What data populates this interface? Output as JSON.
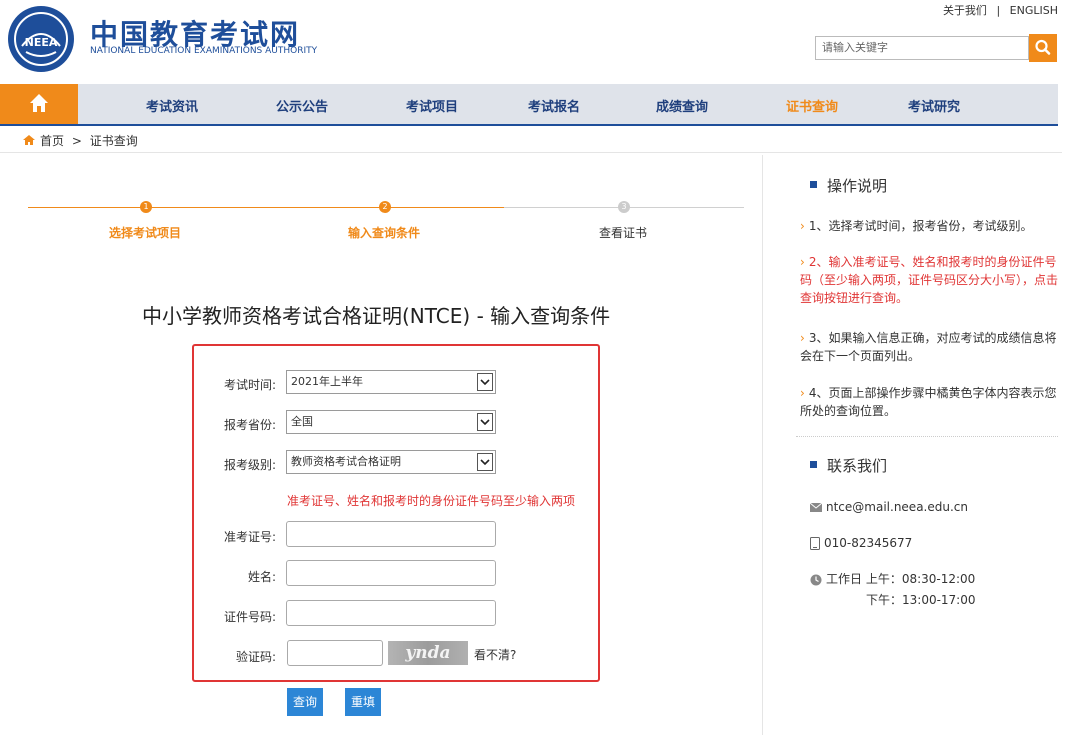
{
  "header": {
    "title": "中国教育考试网",
    "subtitle": "NATIONAL EDUCATION EXAMINATIONS AUTHORITY",
    "logo_text": "NEEA",
    "top_links": {
      "about": "关于我们",
      "sep": "|",
      "english": "ENGLISH"
    },
    "search_placeholder": "请输入关键字"
  },
  "nav": {
    "items": [
      {
        "label": "考试资讯"
      },
      {
        "label": "公示公告"
      },
      {
        "label": "考试项目"
      },
      {
        "label": "考试报名"
      },
      {
        "label": "成绩查询"
      },
      {
        "label": "证书查询",
        "active": true
      },
      {
        "label": "考试研究"
      }
    ]
  },
  "breadcrumb": {
    "home": "首页",
    "sep": ">",
    "current": "证书查询"
  },
  "steps": [
    {
      "num": "1",
      "label": "选择考试项目",
      "state": "done"
    },
    {
      "num": "2",
      "label": "输入查询条件",
      "state": "current"
    },
    {
      "num": "3",
      "label": "查看证书",
      "state": "pending"
    }
  ],
  "main": {
    "title": "中小学教师资格考试合格证明(NTCE) - 输入查询条件",
    "form": {
      "exam_time": {
        "label": "考试时间:",
        "value": "2021年上半年"
      },
      "province": {
        "label": "报考省份:",
        "value": "全国"
      },
      "level": {
        "label": "报考级别:",
        "value": "教师资格考试合格证明"
      },
      "hint": "准考证号、姓名和报考时的身份证件号码至少输入两项",
      "ticket": {
        "label": "准考证号:",
        "value": ""
      },
      "name": {
        "label": "姓名:",
        "value": ""
      },
      "id_number": {
        "label": "证件号码:",
        "value": ""
      },
      "captcha": {
        "label": "验证码:",
        "value": "",
        "image_text": "ynda",
        "refresh": "看不清?"
      }
    },
    "buttons": {
      "query": "查询",
      "reset": "重填"
    }
  },
  "sidebar": {
    "instructions": {
      "title": "操作说明",
      "items": [
        {
          "text": "1、选择考试时间，报考省份，考试级别。",
          "highlight": false
        },
        {
          "text": "2、输入准考证号、姓名和报考时的身份证件号码（至少输入两项，证件号码区分大小写），点击查询按钮进行查询。",
          "highlight": true
        },
        {
          "text": "3、如果输入信息正确，对应考试的成绩信息将会在下一个页面列出。",
          "highlight": false
        },
        {
          "text": "4、页面上部操作步骤中橘黄色字体内容表示您所处的查询位置。",
          "highlight": false
        }
      ]
    },
    "contact": {
      "title": "联系我们",
      "email": "ntce@mail.neea.edu.cn",
      "phone": "010-82345677",
      "hours_am": "工作日 上午：08:30-12:00",
      "hours_pm": "下午：13:00-17:00"
    }
  },
  "colors": {
    "brand": "#1e4e9a",
    "accent": "#f08a1a",
    "alert": "#e03535",
    "button": "#2c86d6"
  }
}
